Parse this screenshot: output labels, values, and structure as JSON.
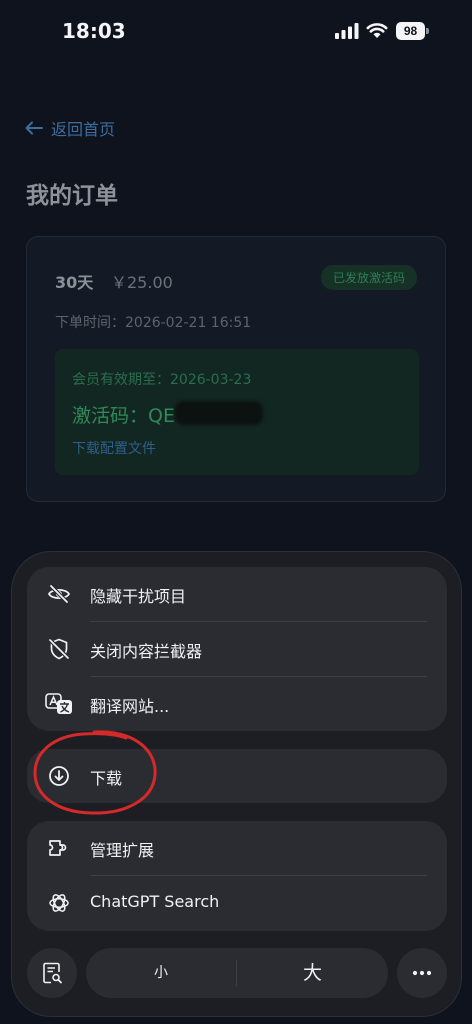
{
  "status_bar": {
    "time": "18:03",
    "battery": "98"
  },
  "page": {
    "back_label": "返回首页",
    "title": "我的订单",
    "order": {
      "plan": "30天",
      "price": "￥25.00",
      "status": "已发放激活码",
      "order_time": "下单时间：2026-02-21 16:51",
      "expiry": "会员有效期至：2026-03-23",
      "activation_code": "激活码：QE          AOR",
      "download_config": "下载配置文件"
    }
  },
  "menu": {
    "group1": [
      {
        "label": "隐藏干扰项目",
        "icon": "eye-slash-icon"
      },
      {
        "label": "关闭内容拦截器",
        "icon": "shield-slash-icon"
      },
      {
        "label": "翻译网站...",
        "icon": "translate-icon"
      }
    ],
    "download": {
      "label": "下载",
      "icon": "download-circle-icon"
    },
    "group3": [
      {
        "label": "管理扩展",
        "icon": "extension-icon"
      },
      {
        "label": "ChatGPT Search",
        "icon": "chatgpt-icon"
      }
    ]
  },
  "bottom_bar": {
    "zoom_small": "小",
    "zoom_large": "大"
  },
  "colors": {
    "background": "#0e131d",
    "sheet": "#1c1e24",
    "group": "#2a2c32",
    "annotation": "#d42a2a",
    "accent_green": "#2f8a58",
    "link_blue": "#3f6d9e"
  }
}
